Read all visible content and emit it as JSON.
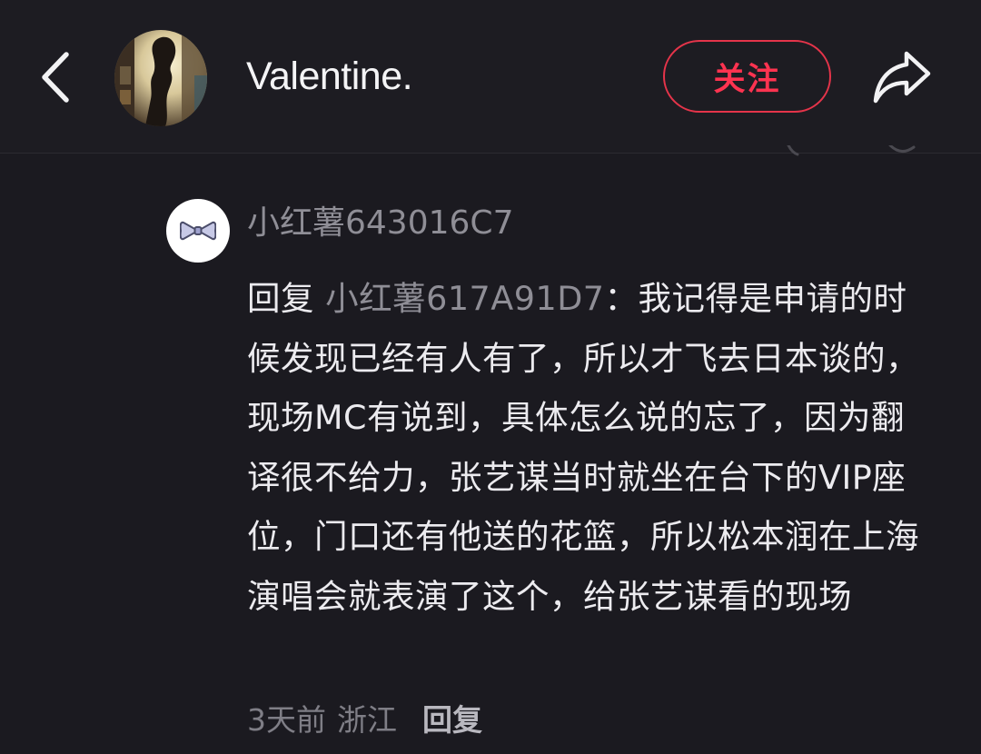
{
  "header": {
    "back_icon": "chevron-left-icon",
    "user_name": "Valentine.",
    "follow_label": "关注",
    "share_icon": "share-arrow-icon",
    "accent_color": "#ff3350"
  },
  "comment": {
    "avatar_icon": "bow-icon",
    "author": "小红薯643016C7",
    "reply_prefix": "回复 ",
    "reply_target": "小红薯617A91D7",
    "text": "：我记得是申请的时候发现已经有人有了，所以才飞去日本谈的，现场MC有说到，具体怎么说的忘了，因为翻译很不给力，张艺谋当时就坐在台下的VIP座位，门口还有他送的花篮，所以松本润在上海演唱会就表演了这个，给张艺谋看的现场",
    "time": "3天前",
    "location": "浙江",
    "reply_label": "回复"
  }
}
